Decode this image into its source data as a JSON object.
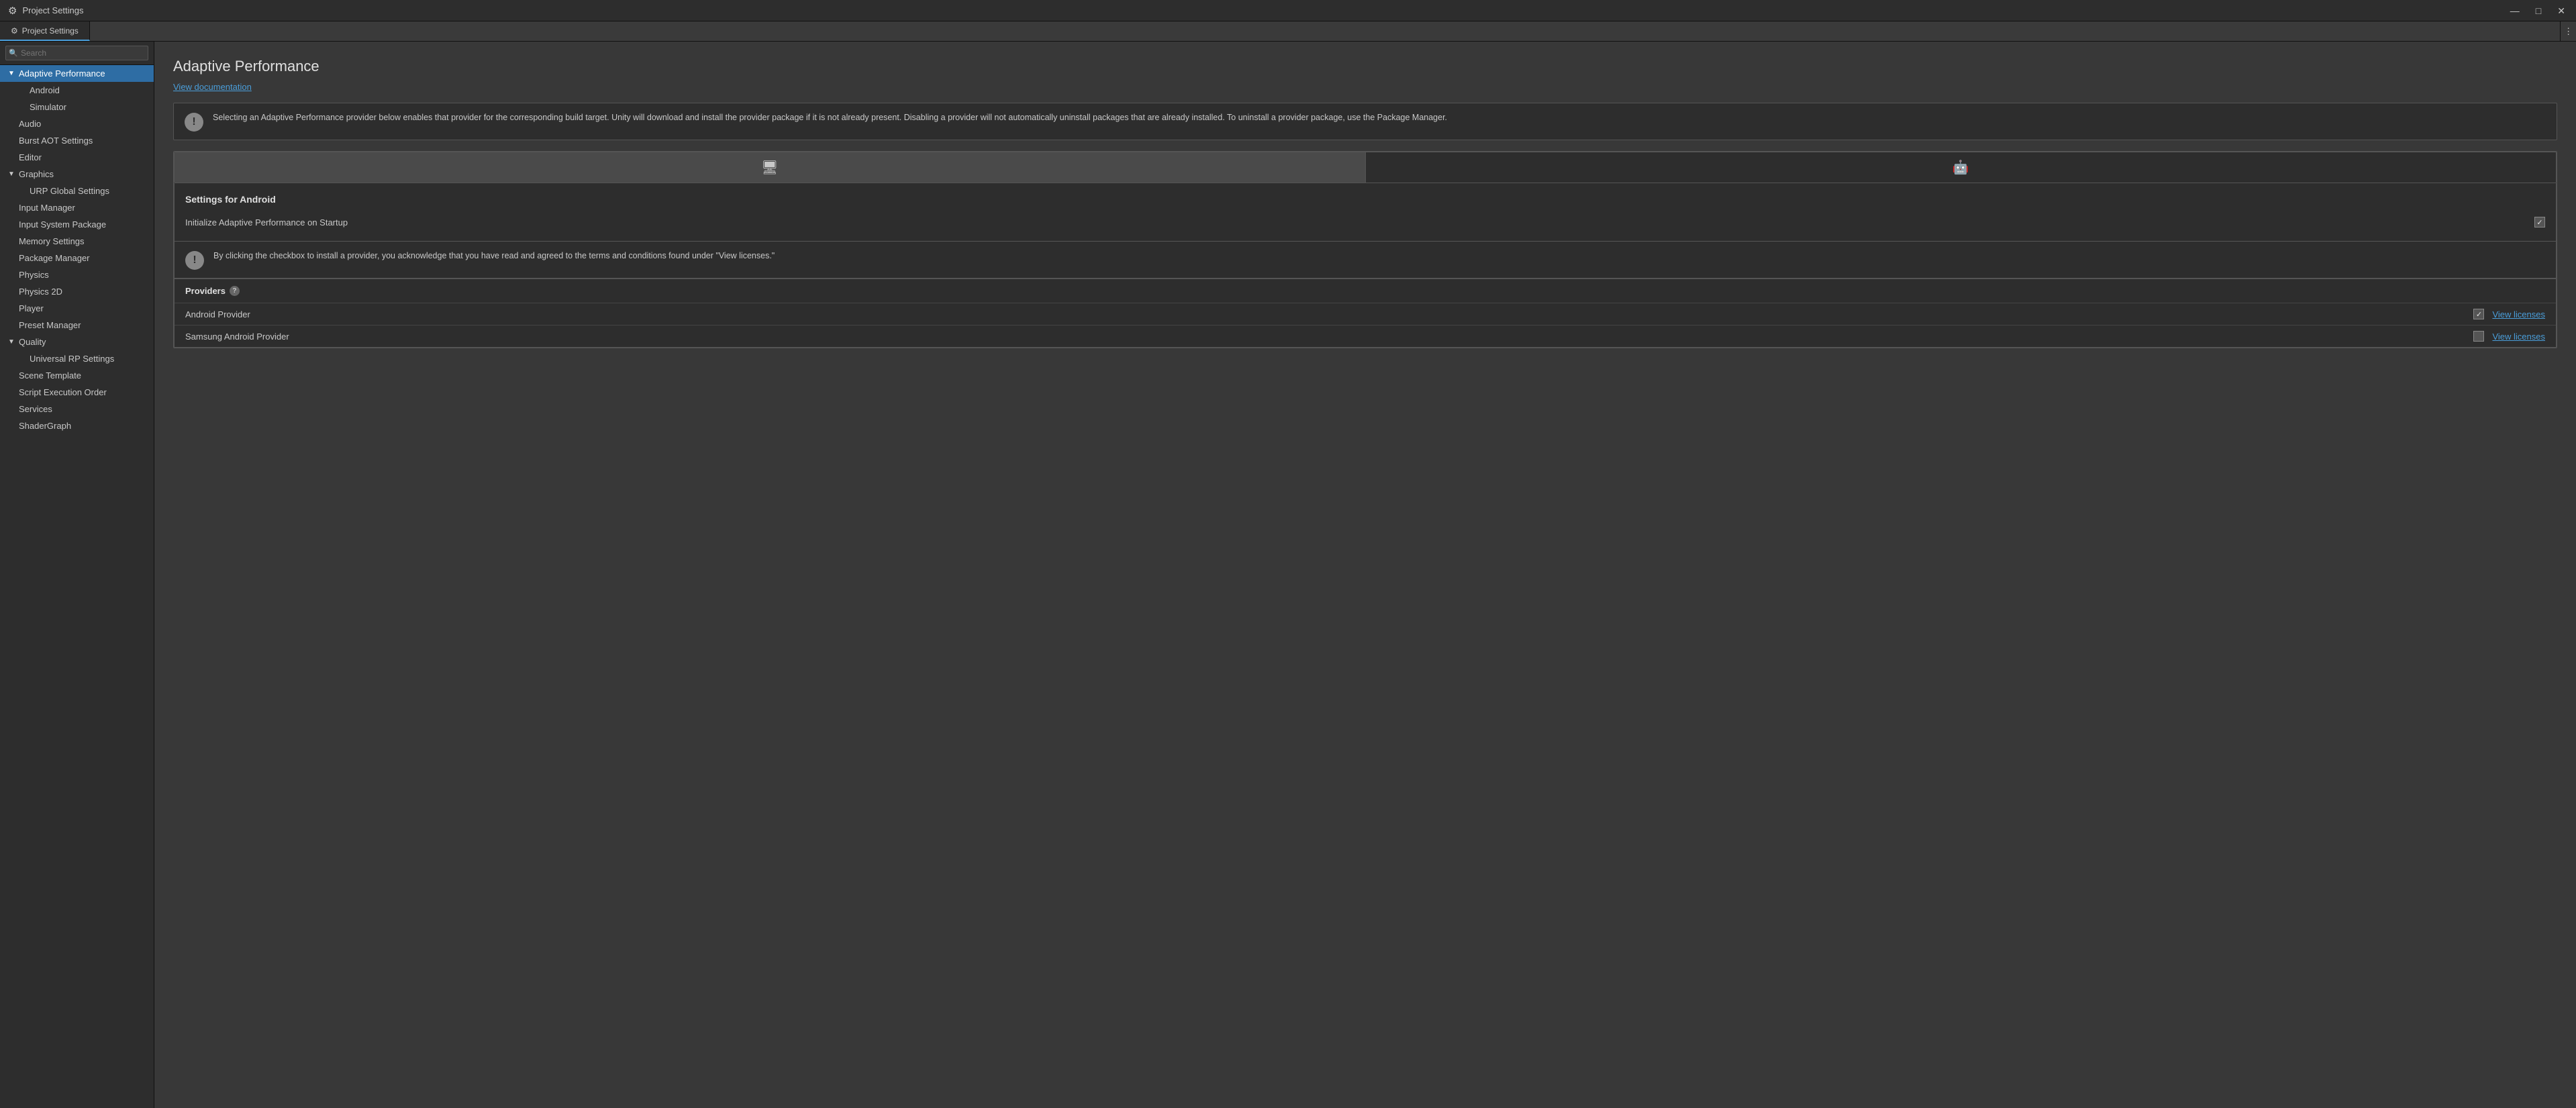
{
  "window": {
    "title": "Project Settings",
    "icon": "⚙"
  },
  "titlebar": {
    "minimize": "—",
    "maximize": "□",
    "close": "✕"
  },
  "tabbar": {
    "tabs": [
      {
        "label": "Project Settings",
        "active": true,
        "icon": "⚙"
      }
    ],
    "more_icon": "⋮"
  },
  "sidebar": {
    "search_placeholder": "Search",
    "items": [
      {
        "label": "Adaptive Performance",
        "indent": 0,
        "arrow": "▼",
        "active": true
      },
      {
        "label": "Android",
        "indent": 1,
        "arrow": ""
      },
      {
        "label": "Simulator",
        "indent": 1,
        "arrow": ""
      },
      {
        "label": "Audio",
        "indent": 0,
        "arrow": ""
      },
      {
        "label": "Burst AOT Settings",
        "indent": 0,
        "arrow": ""
      },
      {
        "label": "Editor",
        "indent": 0,
        "arrow": ""
      },
      {
        "label": "Graphics",
        "indent": 0,
        "arrow": "▼"
      },
      {
        "label": "URP Global Settings",
        "indent": 1,
        "arrow": ""
      },
      {
        "label": "Input Manager",
        "indent": 0,
        "arrow": ""
      },
      {
        "label": "Input System Package",
        "indent": 0,
        "arrow": ""
      },
      {
        "label": "Memory Settings",
        "indent": 0,
        "arrow": ""
      },
      {
        "label": "Package Manager",
        "indent": 0,
        "arrow": ""
      },
      {
        "label": "Physics",
        "indent": 0,
        "arrow": ""
      },
      {
        "label": "Physics 2D",
        "indent": 0,
        "arrow": ""
      },
      {
        "label": "Player",
        "indent": 0,
        "arrow": ""
      },
      {
        "label": "Preset Manager",
        "indent": 0,
        "arrow": ""
      },
      {
        "label": "Quality",
        "indent": 0,
        "arrow": "▼"
      },
      {
        "label": "Universal RP Settings",
        "indent": 1,
        "arrow": ""
      },
      {
        "label": "Scene Template",
        "indent": 0,
        "arrow": ""
      },
      {
        "label": "Script Execution Order",
        "indent": 0,
        "arrow": ""
      },
      {
        "label": "Services",
        "indent": 0,
        "arrow": ""
      },
      {
        "label": "ShaderGraph",
        "indent": 0,
        "arrow": ""
      }
    ]
  },
  "main": {
    "page_title": "Adaptive Performance",
    "view_doc_label": "View documentation",
    "info_message": "Selecting an Adaptive Performance provider below enables that provider for the corresponding build target. Unity will download and install the provider package if it is not already present. Disabling a provider will not automatically uninstall packages that are already installed. To uninstall a provider package, use the Package Manager.",
    "platform_tabs": [
      {
        "icon": "🖥",
        "label": "Desktop",
        "active": true
      },
      {
        "icon": "🤖",
        "label": "Android",
        "active": false
      }
    ],
    "settings_for_label": "Settings for Android",
    "initialize_label": "Initialize Adaptive Performance on Startup",
    "initialize_checked": true,
    "warn_message": "By clicking the checkbox to install a provider, you acknowledge that you have read and agreed to the terms and conditions found under \"View licenses.\"",
    "providers_label": "Providers",
    "providers": [
      {
        "name": "Android Provider",
        "checked": true,
        "view_licenses": "View licenses"
      },
      {
        "name": "Samsung Android Provider",
        "checked": false,
        "view_licenses": "View licenses"
      }
    ]
  }
}
